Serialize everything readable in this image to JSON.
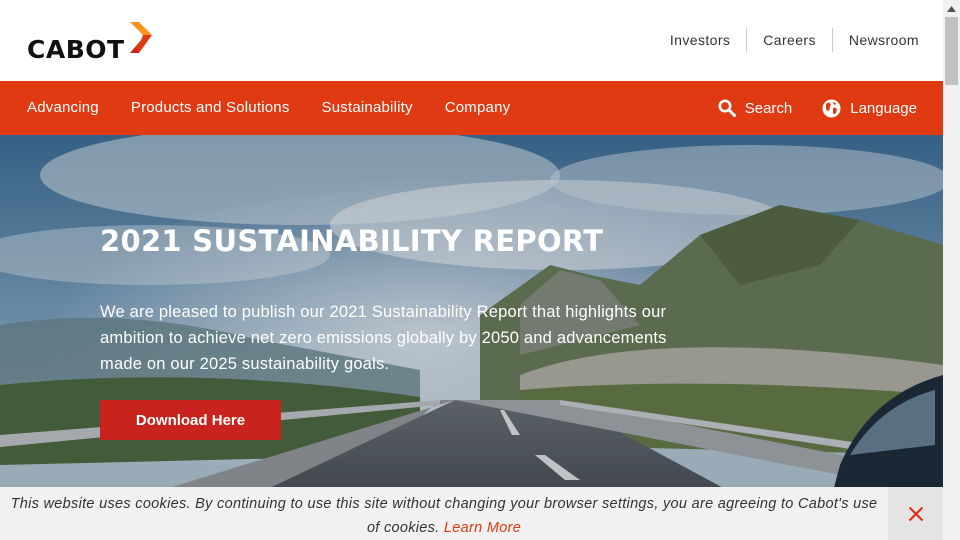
{
  "brand": {
    "name": "CABOT",
    "accent_color": "#e03a13",
    "mark_colors": [
      "#f7941d",
      "#e03a13"
    ]
  },
  "utility_nav": {
    "items": [
      "Investors",
      "Careers",
      "Newsroom"
    ]
  },
  "main_nav": {
    "items": [
      "Advancing",
      "Products and Solutions",
      "Sustainability",
      "Company"
    ],
    "search_label": "Search",
    "search_icon": "search-icon",
    "language_label": "Language",
    "language_icon": "globe-icon"
  },
  "hero": {
    "title": "2021 SUSTAINABILITY REPORT",
    "body_lines": [
      "We are pleased to publish our 2021 Sustainability Report that highlights our",
      "ambition to achieve net zero emissions globally by 2050 and advancements",
      "made on our 2025 sustainability goals."
    ],
    "button_label": "Download Here",
    "button_color": "#c8231c"
  },
  "cookie_notice": {
    "line1": "This website uses cookies. By continuing to use this site without changing your browser settings, you are agreeing to Cabot's use",
    "line2_prefix": "of cookies.",
    "link_text": "Learn More",
    "close_icon": "close-icon"
  }
}
